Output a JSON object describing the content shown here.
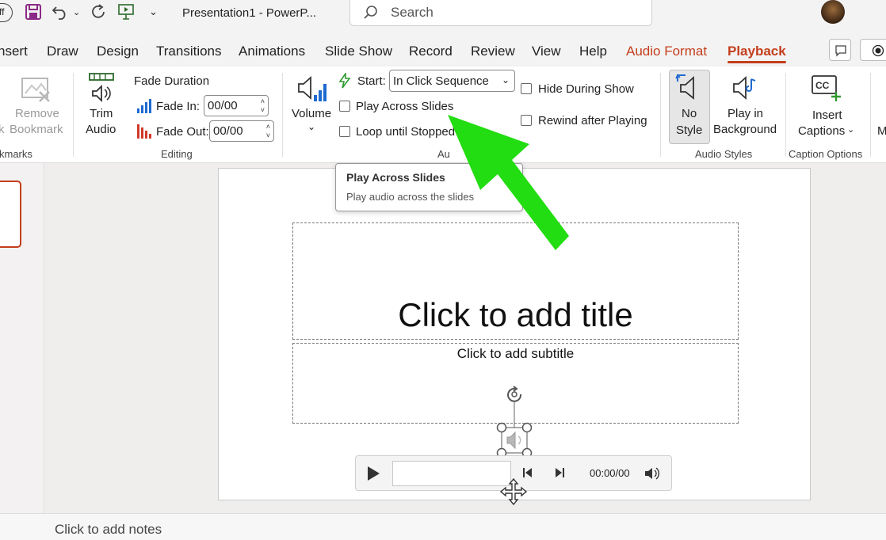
{
  "title_bar": {
    "autosave_fragment": "ff",
    "document_title": "Presentation1 - PowerP...",
    "search_placeholder": "Search"
  },
  "tabs": [
    {
      "label": "nsert",
      "state": "normal"
    },
    {
      "label": "Draw",
      "state": "normal"
    },
    {
      "label": "Design",
      "state": "normal"
    },
    {
      "label": "Transitions",
      "state": "normal"
    },
    {
      "label": "Animations",
      "state": "normal"
    },
    {
      "label": "Slide Show",
      "state": "normal"
    },
    {
      "label": "Record",
      "state": "normal"
    },
    {
      "label": "Review",
      "state": "normal"
    },
    {
      "label": "View",
      "state": "normal"
    },
    {
      "label": "Help",
      "state": "normal"
    },
    {
      "label": "Audio Format",
      "state": "contextual"
    },
    {
      "label": "Playback",
      "state": "active"
    }
  ],
  "ribbon": {
    "bookmarks": {
      "cut_label": "k",
      "remove_line1": "Remove",
      "remove_line2": "Bookmark",
      "group_label": "kmarks"
    },
    "editing": {
      "trim_line1": "Trim",
      "trim_line2": "Audio",
      "fade_duration": "Fade Duration",
      "fade_in_label": "Fade In:",
      "fade_in_value": "00/00",
      "fade_out_label": "Fade Out:",
      "fade_out_value": "00/00",
      "group_label": "Editing"
    },
    "audio_options": {
      "volume": "Volume",
      "start_label": "Start:",
      "start_value": "In Click Sequence",
      "play_across": "Play Across Slides",
      "loop": "Loop until Stopped",
      "hide": "Hide During Show",
      "rewind": "Rewind after Playing",
      "group_label": "Au"
    },
    "audio_styles": {
      "nostyle_line1": "No",
      "nostyle_line2": "Style",
      "bg_line1": "Play in",
      "bg_line2": "Background",
      "group_label": "Audio Styles"
    },
    "captions": {
      "insert_line1": "Insert",
      "insert_line2": "Captions",
      "group_label": "Caption Options",
      "more_fragment": "M"
    }
  },
  "tooltip": {
    "title": "Play Across Slides",
    "desc": "Play audio across the slides"
  },
  "slide": {
    "title_placeholder": "Click to add title",
    "subtitle_placeholder": "Click to add subtitle"
  },
  "player": {
    "time": "00:00/00"
  },
  "notes": {
    "placeholder": "Click to add notes"
  },
  "colors": {
    "accent": "#c43e1c",
    "arrow": "#22dd11"
  }
}
